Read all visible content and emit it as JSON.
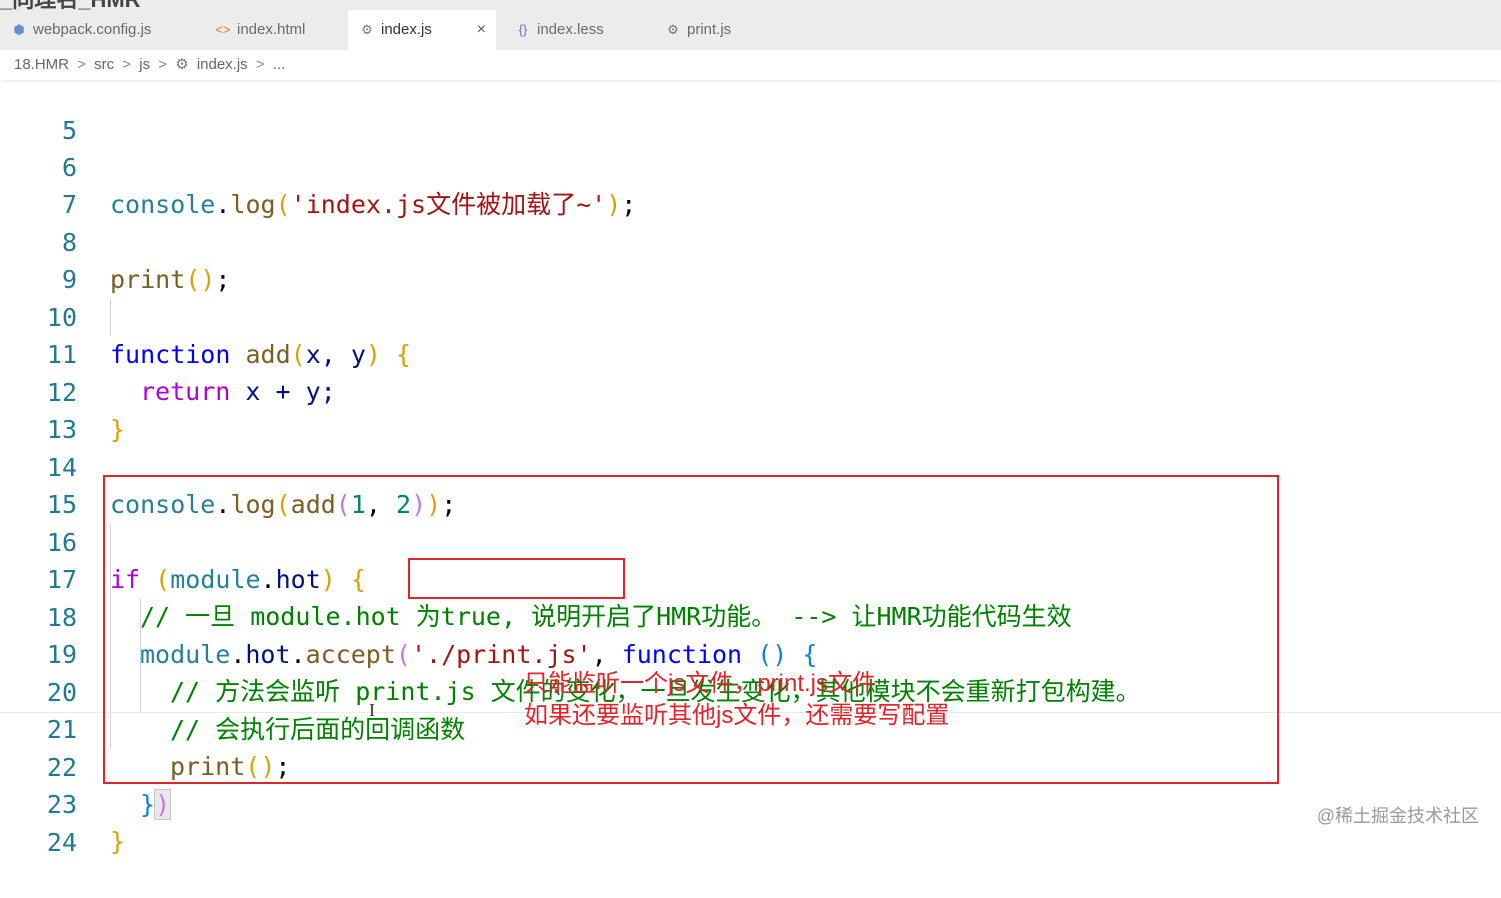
{
  "window": {
    "title": "_同理名_HMR"
  },
  "tabs": [
    {
      "label": "webpack.config.js",
      "icon": "webpack-icon",
      "glyph": "⬢",
      "glyph_color": "#6a8ec7",
      "active": false
    },
    {
      "label": "index.html",
      "icon": "html-icon",
      "glyph": "<>",
      "glyph_color": "#e37933",
      "active": false
    },
    {
      "label": "index.js",
      "icon": "gear-icon",
      "glyph": "⚙",
      "glyph_color": "#777",
      "active": true,
      "close": "×"
    },
    {
      "label": "index.less",
      "icon": "braces-icon",
      "glyph": "{}",
      "glyph_color": "#6c73c4",
      "active": false
    },
    {
      "label": "print.js",
      "icon": "gear-icon",
      "glyph": "⚙",
      "glyph_color": "#777",
      "active": false
    }
  ],
  "breadcrumb": {
    "items": [
      "18.HMR",
      "src",
      "js",
      "index.js",
      "..."
    ],
    "separator": ">",
    "file_icon": "⚙"
  },
  "line_numbers": [
    "5",
    "6",
    "7",
    "8",
    "9",
    "10",
    "11",
    "12",
    "13",
    "14",
    "15",
    "16",
    "17",
    "18",
    "19",
    "20",
    "21",
    "22",
    "23",
    "24"
  ],
  "code": {
    "l6_obj": "console",
    "l6_dot": ".",
    "l6_fn": "log",
    "l6_open": "(",
    "l6_str": "'index.js文件被加载了~'",
    "l6_close": ")",
    "l6_semi": ";",
    "l8_fn": "print",
    "l8_parens": "()",
    "l8_semi": ";",
    "l10_kw": "function",
    "l10_fn": "add",
    "l10_open": "(",
    "l10_args": "x, y",
    "l10_close": ")",
    "l10_brace": "{",
    "l11_kw": "return",
    "l11_expr": "x + y;",
    "l12_brace": "}",
    "l14_obj": "console",
    "l14_dot": ".",
    "l14_fn": "log",
    "l14_open1": "(",
    "l14_fn2": "add",
    "l14_open2": "(",
    "l14_n1": "1",
    "l14_comma": ", ",
    "l14_n2": "2",
    "l14_close2": ")",
    "l14_close1": ")",
    "l14_semi": ";",
    "l16_kw": "if",
    "l16_open": "(",
    "l16_obj": "module",
    "l16_dot": ".",
    "l16_prop": "hot",
    "l16_close": ")",
    "l16_brace": "{",
    "l17_comment": "// 一旦 module.hot 为true, 说明开启了HMR功能。 --> 让HMR功能代码生效",
    "l18_obj": "module",
    "l18_dot1": ".",
    "l18_prop": "hot",
    "l18_dot2": ".",
    "l18_fn": "accept",
    "l18_open": "(",
    "l18_str": "'./print.js'",
    "l18_comma": ", ",
    "l18_kw": "function",
    "l18_parens": "()",
    "l18_brace": "{",
    "l19_comment": "// 方法会监听 print.js 文件的变化，一旦发生变化，其他模块不会重新打包构建。",
    "l20_comment": "// 会执行后面的回调函数",
    "l21_fn": "print",
    "l21_parens": "()",
    "l21_semi": ";",
    "l22_brace": "}",
    "l22_paren": ")",
    "l23_brace": "}"
  },
  "annotation": {
    "line1": "只能监听一个js文件，print.js文件",
    "line2": "如果还要监听其他js文件，还需要写配置",
    "color": "#e0242b"
  },
  "cursor_glyph": "I",
  "watermark": "@稀土掘金技术社区"
}
